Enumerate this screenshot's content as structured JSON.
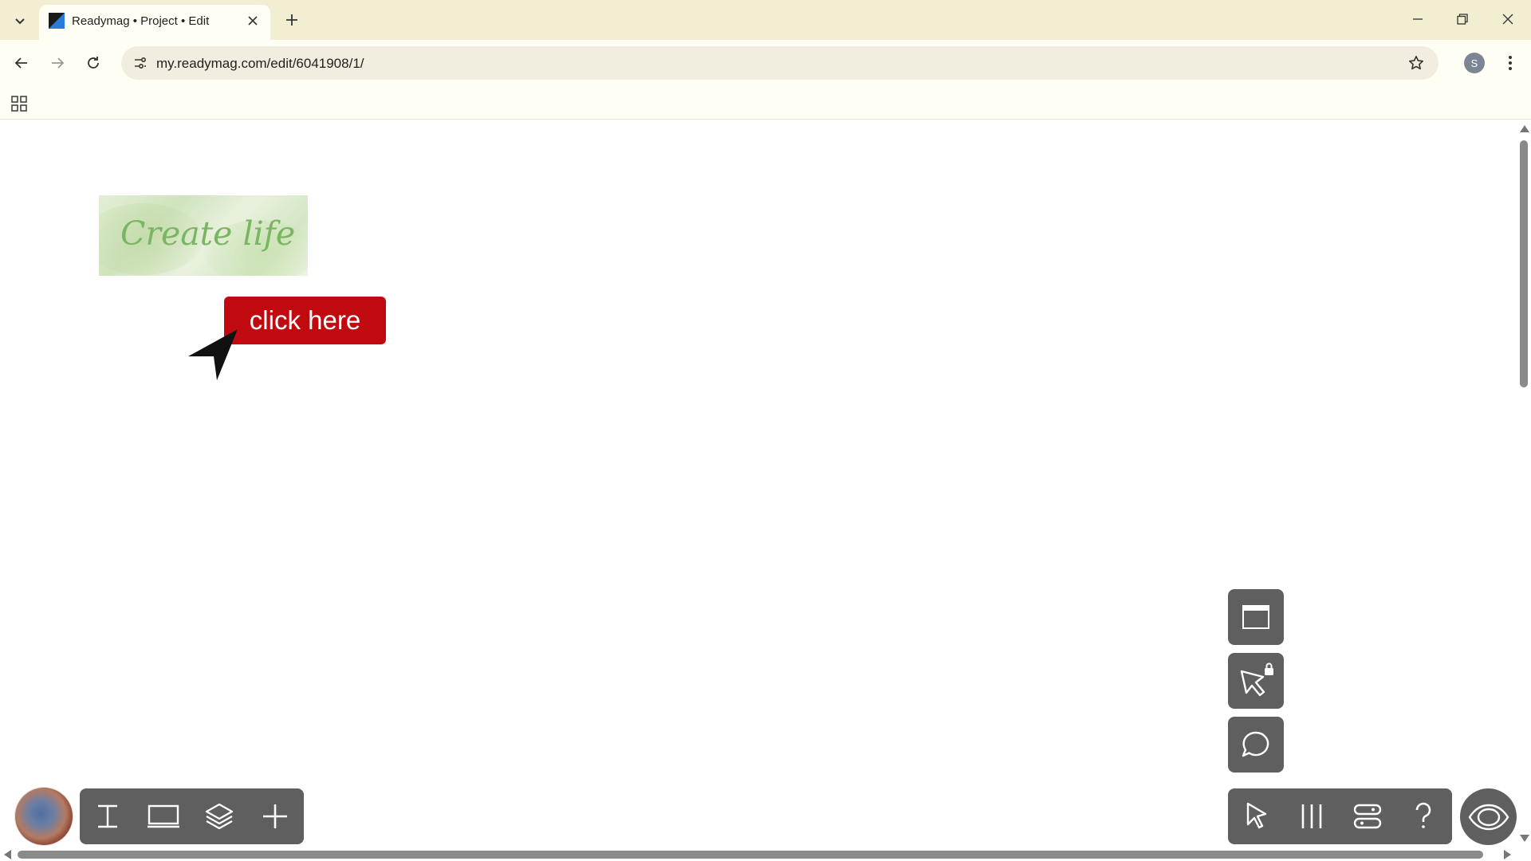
{
  "browser": {
    "tab_title": "Readymag • Project • Edit",
    "url": "my.readymag.com/edit/6041908/1/",
    "profile_initial": "S",
    "icons": [
      "tab-search-icon",
      "favicon-icon",
      "close-icon",
      "plus-icon",
      "minimize-icon",
      "restore-icon",
      "close-window-icon",
      "back-icon",
      "forward-icon",
      "reload-icon",
      "site-info-icon",
      "star-icon",
      "more-icon",
      "apps-icon"
    ]
  },
  "canvas": {
    "hero_text": "Create life",
    "button_label": "click here",
    "colors": {
      "button": "#c10a10",
      "hero_text": "#79b563",
      "controls": "#5f5f5f"
    }
  },
  "editor": {
    "left_panel_icons": [
      "text-tool-icon",
      "page-icon",
      "layers-icon",
      "add-icon"
    ],
    "right_side_icons": [
      "widget-icon",
      "pointer-lock-icon",
      "comment-icon"
    ],
    "right_panel_icons": [
      "select-pointer-icon",
      "columns-icon",
      "settings-toggle-icon",
      "help-icon"
    ],
    "preview_icon": "eye-icon"
  }
}
